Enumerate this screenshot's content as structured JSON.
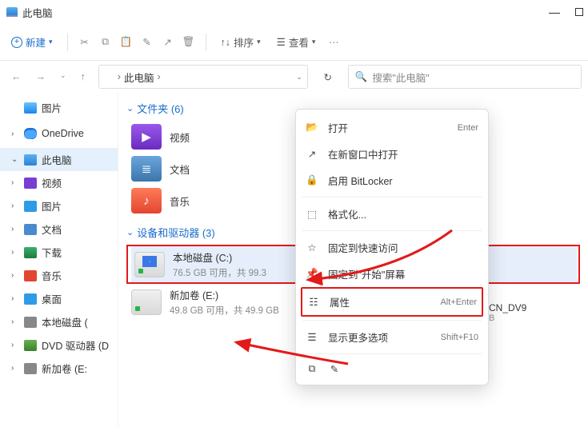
{
  "window": {
    "title": "此电脑",
    "minimize": "—",
    "maximize": "▢",
    "close": "✕"
  },
  "toolbar": {
    "new_label": "新建",
    "sort_label": "排序",
    "view_label": "查看"
  },
  "address": {
    "location": "此电脑",
    "sep": "›"
  },
  "search": {
    "placeholder": "搜索\"此电脑\""
  },
  "sidebar": {
    "items": [
      {
        "label": "图片",
        "expander": ""
      },
      {
        "label": "OneDrive",
        "expander": ">"
      },
      {
        "label": "此电脑",
        "expander": "v",
        "active": true
      },
      {
        "label": "视频",
        "expander": ">"
      },
      {
        "label": "图片",
        "expander": ">"
      },
      {
        "label": "文档",
        "expander": ">"
      },
      {
        "label": "下载",
        "expander": ">"
      },
      {
        "label": "音乐",
        "expander": ">"
      },
      {
        "label": "桌面",
        "expander": ">"
      },
      {
        "label": "本地磁盘 (",
        "expander": ">"
      },
      {
        "label": "DVD 驱动器 (D",
        "expander": ">"
      },
      {
        "label": "新加卷 (E:",
        "expander": ">"
      }
    ]
  },
  "content": {
    "folders_header": "文件夹 (6)",
    "devices_header": "设备和驱动器 (3)",
    "tiles": {
      "video": "视频",
      "documents": "文档",
      "music": "音乐"
    },
    "drives": [
      {
        "name": "本地磁盘 (C:)",
        "sub": "76.5 GB 可用，共 99.3"
      },
      {
        "name": "新加卷 (E:)",
        "sub": "49.8 GB 可用，共 49.9 GB"
      }
    ],
    "dvd_right": {
      "name": "CN_DV9",
      "sub": "B"
    }
  },
  "context": {
    "open": {
      "label": "打开",
      "hint": "Enter"
    },
    "open_new": "在新窗口中打开",
    "bitlocker": "启用 BitLocker",
    "format": "格式化...",
    "pin_quick": "固定到快速访问",
    "pin_start": "固定到\"开始\"屏幕",
    "properties": {
      "label": "属性",
      "hint": "Alt+Enter"
    },
    "more": {
      "label": "显示更多选项",
      "hint": "Shift+F10"
    }
  }
}
